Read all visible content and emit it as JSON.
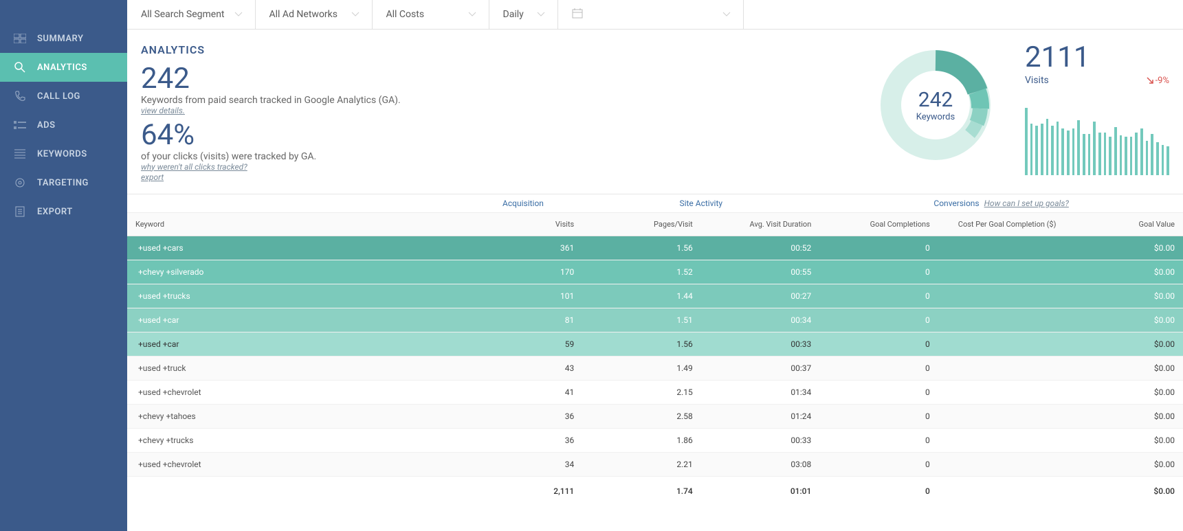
{
  "sidebar": {
    "items": [
      {
        "label": "SUMMARY",
        "icon": "dashboard-icon"
      },
      {
        "label": "ANALYTICS",
        "icon": "search-icon"
      },
      {
        "label": "CALL LOG",
        "icon": "phone-icon"
      },
      {
        "label": "ADS",
        "icon": "ads-icon"
      },
      {
        "label": "KEYWORDS",
        "icon": "list-icon"
      },
      {
        "label": "TARGETING",
        "icon": "target-icon"
      },
      {
        "label": "EXPORT",
        "icon": "document-icon"
      }
    ],
    "active_index": 1
  },
  "filters": {
    "segment": "All Search Segment",
    "networks": "All Ad Networks",
    "costs": "All Costs",
    "interval": "Daily",
    "date": ""
  },
  "header": {
    "title": "ANALYTICS",
    "keywords_count": "242",
    "keywords_caption": "Keywords from paid search tracked in Google Analytics (GA).",
    "view_details": "view details.",
    "tracked_pct": "64%",
    "tracked_caption": "of your clicks (visits) were tracked by GA.",
    "why_link": "why weren't all clicks tracked?",
    "export": "export"
  },
  "donut": {
    "value": "242",
    "label": "Keywords"
  },
  "visits_panel": {
    "value": "2111",
    "label": "Visits",
    "delta": "-9%"
  },
  "chart_data": {
    "type": "bar",
    "title": "Visits over time",
    "series": [
      {
        "name": "Visits",
        "values": [
          98,
          75,
          72,
          75,
          82,
          72,
          78,
          68,
          65,
          68,
          80,
          60,
          60,
          78,
          62,
          62,
          56,
          70,
          58,
          56,
          56,
          62,
          68,
          50,
          60,
          48,
          44,
          42
        ]
      }
    ],
    "ylim": [
      0,
      100
    ]
  },
  "table": {
    "groups": {
      "keyword": "Keyword",
      "acquisition": "Acquisition",
      "site_activity": "Site Activity",
      "conversions": "Conversions",
      "goals_link": "How can I set up goals?"
    },
    "cols": {
      "keyword": "Keyword",
      "visits": "Visits",
      "pages_visit": "Pages/Visit",
      "avg_duration": "Avg. Visit Duration",
      "goal_completions": "Goal Completions",
      "cost_per_goal": "Cost Per Goal Completion ($)",
      "goal_value": "Goal Value"
    },
    "rows": [
      {
        "keyword": "+used +cars",
        "visits": "361",
        "pages": "1.56",
        "dur": "00:52",
        "gc": "0",
        "cpg": "",
        "gv": "$0.00"
      },
      {
        "keyword": "+chevy +silverado",
        "visits": "170",
        "pages": "1.52",
        "dur": "00:55",
        "gc": "0",
        "cpg": "",
        "gv": "$0.00"
      },
      {
        "keyword": "+used +trucks",
        "visits": "101",
        "pages": "1.44",
        "dur": "00:27",
        "gc": "0",
        "cpg": "",
        "gv": "$0.00"
      },
      {
        "keyword": "+used +car",
        "visits": "81",
        "pages": "1.51",
        "dur": "00:34",
        "gc": "0",
        "cpg": "",
        "gv": "$0.00"
      },
      {
        "keyword": "+used +car",
        "visits": "59",
        "pages": "1.56",
        "dur": "00:33",
        "gc": "0",
        "cpg": "",
        "gv": "$0.00"
      },
      {
        "keyword": "+used +truck",
        "visits": "43",
        "pages": "1.49",
        "dur": "00:37",
        "gc": "0",
        "cpg": "",
        "gv": "$0.00"
      },
      {
        "keyword": "+used +chevrolet",
        "visits": "41",
        "pages": "2.15",
        "dur": "01:34",
        "gc": "0",
        "cpg": "",
        "gv": "$0.00"
      },
      {
        "keyword": "+chevy +tahoes",
        "visits": "36",
        "pages": "2.58",
        "dur": "01:24",
        "gc": "0",
        "cpg": "",
        "gv": "$0.00"
      },
      {
        "keyword": "+chevy +trucks",
        "visits": "36",
        "pages": "1.86",
        "dur": "00:33",
        "gc": "0",
        "cpg": "",
        "gv": "$0.00"
      },
      {
        "keyword": "+used +chevrolet",
        "visits": "34",
        "pages": "2.21",
        "dur": "03:08",
        "gc": "0",
        "cpg": "",
        "gv": "$0.00"
      }
    ],
    "totals": {
      "visits": "2,111",
      "pages": "1.74",
      "dur": "01:01",
      "gc": "0",
      "cpg": "",
      "gv": "$0.00"
    }
  }
}
